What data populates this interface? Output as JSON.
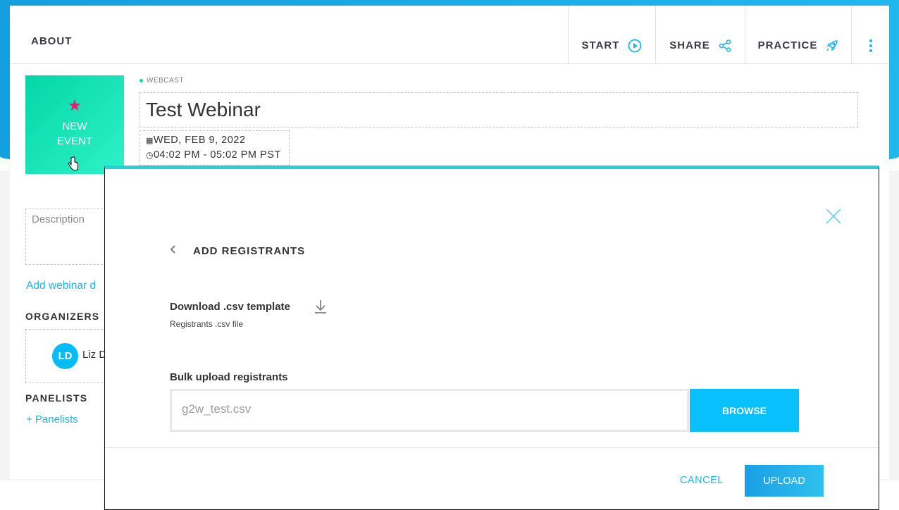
{
  "header": {
    "about": "ABOUT",
    "start": "START",
    "share": "SHARE",
    "practice": "PRACTICE"
  },
  "tile": {
    "line1": "NEW",
    "line2": "EVENT"
  },
  "event": {
    "type": "WEBCAST",
    "title": "Test Webinar",
    "date": "WED, FEB 9, 2022",
    "time": "04:02 PM - 05:02 PM PST"
  },
  "sidebar": {
    "description_placeholder": "Description",
    "add_link": "Add webinar d",
    "organizers": "ORGANIZERS",
    "organizer_initials": "LD",
    "organizer_name": "Liz D",
    "panelists": "PANELISTS",
    "add_panelists": "+ Panelists"
  },
  "modal": {
    "title": "ADD REGISTRANTS",
    "download_label": "Download .csv template",
    "download_sub": "Registrants .csv file",
    "bulk_label": "Bulk upload registrants",
    "file_value": "g2w_test.csv",
    "browse": "BROWSE",
    "cancel": "CANCEL",
    "upload": "UPLOAD"
  },
  "colors": {
    "accent": "#07c0fc",
    "tile": "#04d6a8",
    "star": "#ee1871",
    "modal_top": "#26cfd9"
  }
}
